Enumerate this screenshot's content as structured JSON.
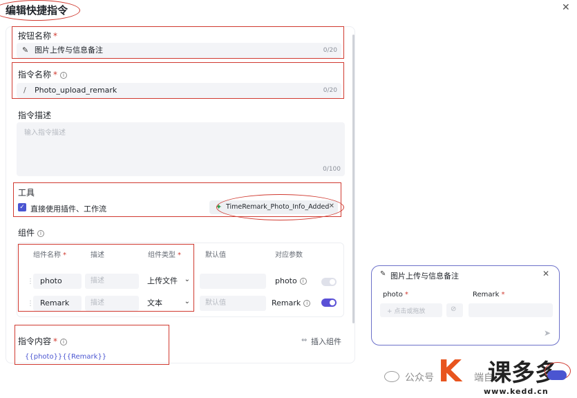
{
  "dialog": {
    "title": "编辑快捷指令"
  },
  "button_name": {
    "label": "按钮名称",
    "required": "*",
    "value": "图片上传与信息备注",
    "count": "0/20"
  },
  "command_name": {
    "label": "指令名称",
    "required": "*",
    "prefix": "/",
    "value": "Photo_upload_remark",
    "count": "0/20"
  },
  "command_desc": {
    "label": "指令描述",
    "placeholder": "输入指令描述",
    "count": "0/100"
  },
  "tools": {
    "label": "工具",
    "checkbox_label": "直接使用插件、工作流",
    "checked": true,
    "chip_label": "TimeRemark_Photo_Info_Added"
  },
  "components": {
    "label": "组件",
    "headers": {
      "name": "组件名称",
      "name_required": "*",
      "desc": "描述",
      "type": "组件类型",
      "type_required": "*",
      "default": "默认值",
      "param": "对应参数"
    },
    "rows": [
      {
        "name": "photo",
        "desc_placeholder": "描述",
        "type": "上传文件",
        "default_placeholder": "",
        "param": "photo",
        "toggle_on": false
      },
      {
        "name": "Remark",
        "desc_placeholder": "描述",
        "type": "文本",
        "default_placeholder": "默认值",
        "param": "Remark",
        "toggle_on": true
      }
    ]
  },
  "command_content": {
    "label": "指令内容",
    "required": "*",
    "insert_label": "插入组件",
    "value": "{{photo}}{{Remark}}"
  },
  "preview": {
    "title": "图片上传与信息备注",
    "field1_label": "photo",
    "field1_required": "*",
    "field1_placeholder": "+ 点击或拖放",
    "field2_label": "Remark",
    "field2_required": "*"
  },
  "watermark": {
    "text": "公众号",
    "partial": "端自",
    "logo_cn": "课多多",
    "logo_url": "www.kedd.cn"
  },
  "colors": {
    "accent": "#4a55d1",
    "annotation_red": "#d0392f",
    "logo_orange": "#e8541e"
  }
}
